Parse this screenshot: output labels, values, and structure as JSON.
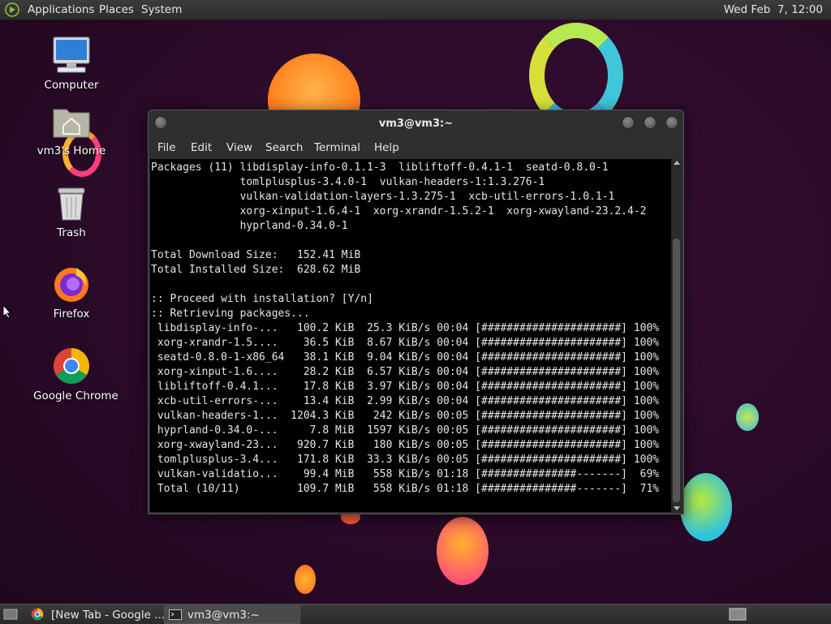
{
  "top_panel": {
    "menus": [
      "Applications",
      "Places",
      "System"
    ],
    "clock": "Wed Feb  7, 12:00"
  },
  "desktop_icons": [
    {
      "label": "Computer",
      "icon": "computer-icon"
    },
    {
      "label": "vm3's Home",
      "icon": "home-folder-icon"
    },
    {
      "label": "Trash",
      "icon": "trash-icon"
    },
    {
      "label": "Firefox",
      "icon": "firefox-icon"
    },
    {
      "label": "Google Chrome",
      "icon": "chrome-icon"
    }
  ],
  "terminal": {
    "title": "vm3@vm3:~",
    "menu": [
      "File",
      "Edit",
      "View",
      "Search",
      "Terminal",
      "Help"
    ],
    "lines": [
      "Packages (11) libdisplay-info-0.1.1-3  libliftoff-0.4.1-1  seatd-0.8.0-1",
      "              tomlplusplus-3.4.0-1  vulkan-headers-1:1.3.276-1",
      "              vulkan-validation-layers-1.3.275-1  xcb-util-errors-1.0.1-1",
      "              xorg-xinput-1.6.4-1  xorg-xrandr-1.5.2-1  xorg-xwayland-23.2.4-2",
      "              hyprland-0.34.0-1",
      "",
      "Total Download Size:   152.41 MiB",
      "Total Installed Size:  628.62 MiB",
      "",
      ":: Proceed with installation? [Y/n]",
      ":: Retrieving packages...",
      " libdisplay-info-...   100.2 KiB  25.3 KiB/s 00:04 [######################] 100%",
      " xorg-xrandr-1.5....    36.5 KiB  8.67 KiB/s 00:04 [######################] 100%",
      " seatd-0.8.0-1-x86_64   38.1 KiB  9.04 KiB/s 00:04 [######################] 100%",
      " xorg-xinput-1.6....    28.2 KiB  6.57 KiB/s 00:04 [######################] 100%",
      " libliftoff-0.4.1...    17.8 KiB  3.97 KiB/s 00:04 [######################] 100%",
      " xcb-util-errors-...    13.4 KiB  2.99 KiB/s 00:04 [######################] 100%",
      " vulkan-headers-1...  1204.3 KiB   242 KiB/s 00:05 [######################] 100%",
      " hyprland-0.34.0-...     7.8 MiB  1597 KiB/s 00:05 [######################] 100%",
      " xorg-xwayland-23...   920.7 KiB   180 KiB/s 00:05 [######################] 100%",
      " tomlplusplus-3.4...   171.8 KiB  33.3 KiB/s 00:05 [######################] 100%",
      " vulkan-validatio...    99.4 MiB   558 KiB/s 01:18 [###############-------]  69%",
      " Total (10/11)         109.7 MiB   558 KiB/s 01:18 [###############-------]  71%"
    ]
  },
  "taskbar": {
    "tasks": [
      {
        "label": "[New Tab - Google ...",
        "icon": "chrome-icon"
      },
      {
        "label": "vm3@vm3:~",
        "icon": "terminal-icon"
      }
    ]
  }
}
